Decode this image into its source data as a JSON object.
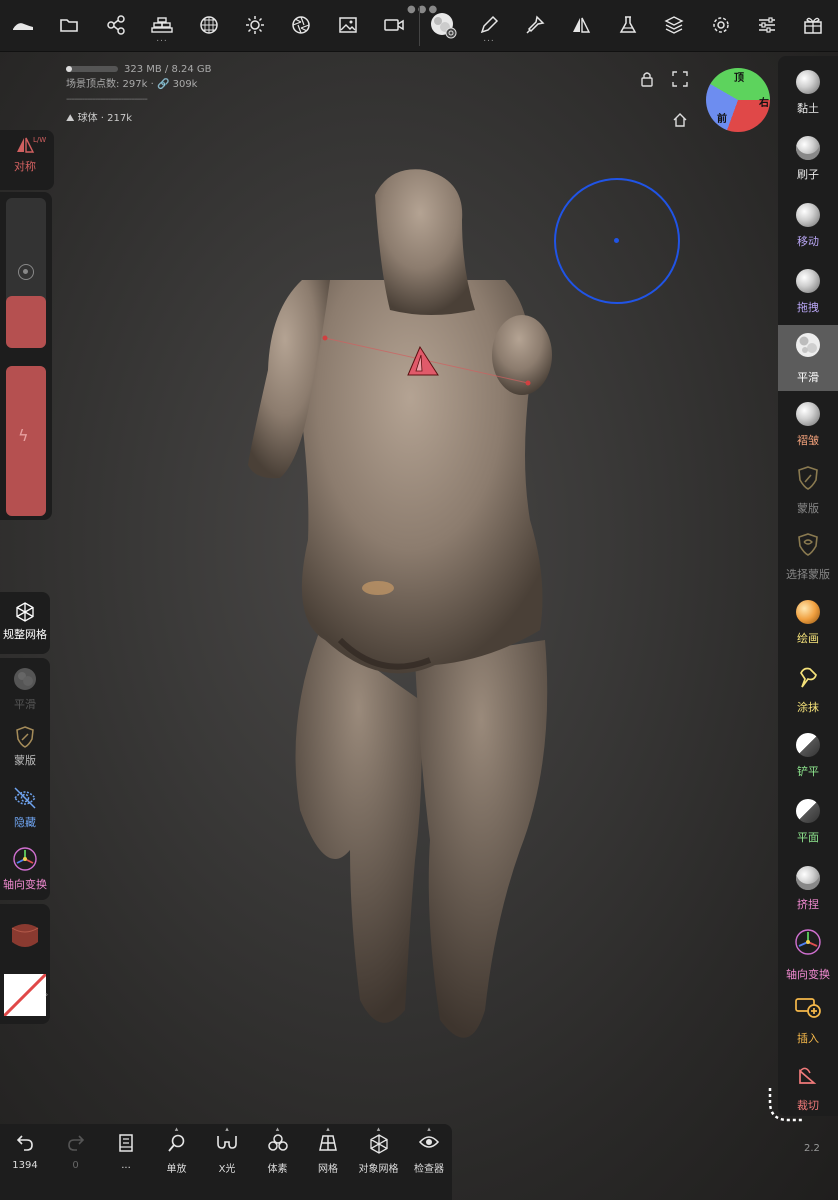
{
  "top_toolbar": {
    "left_icons": [
      "home-icon",
      "folder-icon",
      "share-icon",
      "bricks-icon",
      "sphere-grid-icon",
      "sun-icon",
      "aperture-icon",
      "image-icon",
      "camera-icon"
    ],
    "right_icons": [
      "brush-preview-icon",
      "pencil-icon",
      "stamp-icon",
      "symmetry-icon",
      "flask-icon",
      "layers-icon",
      "gear-icon",
      "sliders-icon",
      "gift-icon"
    ],
    "bricks_more": "...",
    "pencil_more": "..."
  },
  "stats": {
    "memory": "323 MB / 8.24 GB",
    "vertex_label": "场景顶点数: 297k · 🔗 309k",
    "divider": "-------------------------------",
    "object_name": "球体",
    "object_count": "· 217k"
  },
  "gizmo": {
    "top": "顶",
    "front": "前",
    "right": "右"
  },
  "left_panel": {
    "symmetry_label": "对称",
    "symmetry_badge": "L/W",
    "remesh_label": "规整网格",
    "smooth_label": "平滑",
    "mask_label": "蒙版",
    "hide_label": "隐藏",
    "gizmo_label": "轴向变换",
    "slider_top_fill": 0.35,
    "slider_bottom_fill": 1.0
  },
  "right_tools": [
    {
      "label": "黏土",
      "color": "#e8e8e8",
      "icon": "clay-sphere-icon"
    },
    {
      "label": "刷子",
      "color": "#e8e8e8",
      "icon": "brush-sphere-icon"
    },
    {
      "label": "移动",
      "color": "#b9a6f5",
      "icon": "move-sphere-icon"
    },
    {
      "label": "拖拽",
      "color": "#b9a6f5",
      "icon": "drag-sphere-icon"
    },
    {
      "label": "平滑",
      "color": "#ffffff",
      "icon": "smooth-icon",
      "active": true
    },
    {
      "label": "褶皱",
      "color": "#f0a07a",
      "icon": "crease-sphere-icon"
    },
    {
      "label": "蒙版",
      "color": "#888888",
      "icon": "mask-shield-icon"
    },
    {
      "label": "选择蒙版",
      "color": "#888888",
      "icon": "select-mask-icon"
    },
    {
      "label": "绘画",
      "color": "#f5e27a",
      "icon": "paint-sphere-icon"
    },
    {
      "label": "涂抹",
      "color": "#f5e27a",
      "icon": "smudge-icon"
    },
    {
      "label": "铲平",
      "color": "#8fe88f",
      "icon": "flatten-sphere-icon"
    },
    {
      "label": "平面",
      "color": "#8fe88f",
      "icon": "plane-sphere-icon"
    },
    {
      "label": "挤捏",
      "color": "#f08ad0",
      "icon": "pinch-sphere-icon"
    },
    {
      "label": "轴向变换",
      "color": "#f08ad0",
      "icon": "transform-gizmo-icon"
    },
    {
      "label": "插入",
      "color": "#f5b84a",
      "icon": "insert-icon"
    },
    {
      "label": "裁切",
      "color": "#f07a7a",
      "icon": "trim-icon"
    }
  ],
  "bottom_bar": [
    {
      "label": "1394",
      "icon": "undo-icon",
      "dim": false
    },
    {
      "label": "0",
      "icon": "redo-icon",
      "dim": true
    },
    {
      "label": "...",
      "icon": "book-icon",
      "dim": false
    },
    {
      "label": "单放",
      "icon": "search-icon",
      "dim": false
    },
    {
      "label": "X光",
      "icon": "glasses-icon",
      "dim": false
    },
    {
      "label": "体素",
      "icon": "voxel-icon",
      "dim": false
    },
    {
      "label": "网格",
      "icon": "grid-icon",
      "dim": false
    },
    {
      "label": "对象网格",
      "icon": "object-mesh-icon",
      "dim": false
    },
    {
      "label": "检查器",
      "icon": "inspector-eye-icon",
      "dim": false
    }
  ],
  "version": "2.2"
}
